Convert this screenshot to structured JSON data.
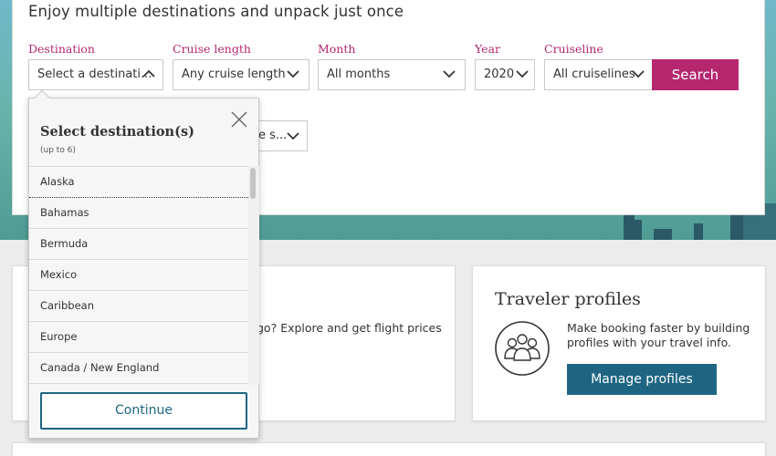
{
  "hero": {
    "headline": "Enjoy multiple destinations and unpack just once"
  },
  "search": {
    "destination": {
      "label": "Destination",
      "value": "Select a destinati..."
    },
    "cruise_length": {
      "label": "Cruise length",
      "value": "Any cruise length"
    },
    "month": {
      "label": "Month",
      "value": "All months"
    },
    "year": {
      "label": "Year",
      "value": "2020"
    },
    "cruiseline": {
      "label": "Cruiseline",
      "value": "All cruiselines"
    },
    "search_button": "Search",
    "extra_select_value": "e s..."
  },
  "dropdown": {
    "title": "Select destination(s)",
    "subtitle": "(up to 6)",
    "items": [
      "Alaska",
      "Bahamas",
      "Bermuda",
      "Mexico",
      "Caribbean",
      "Europe",
      "Canada / New England"
    ],
    "continue_button": "Continue"
  },
  "flight_card": {
    "text": "go? Explore and get flight prices"
  },
  "traveler_card": {
    "title": "Traveler profiles",
    "text_line1": "Make booking faster by building",
    "text_line2": "profiles with your travel info.",
    "button": "Manage profiles"
  },
  "colors": {
    "accent_magenta": "#b5276f",
    "accent_blue": "#1e6583"
  }
}
